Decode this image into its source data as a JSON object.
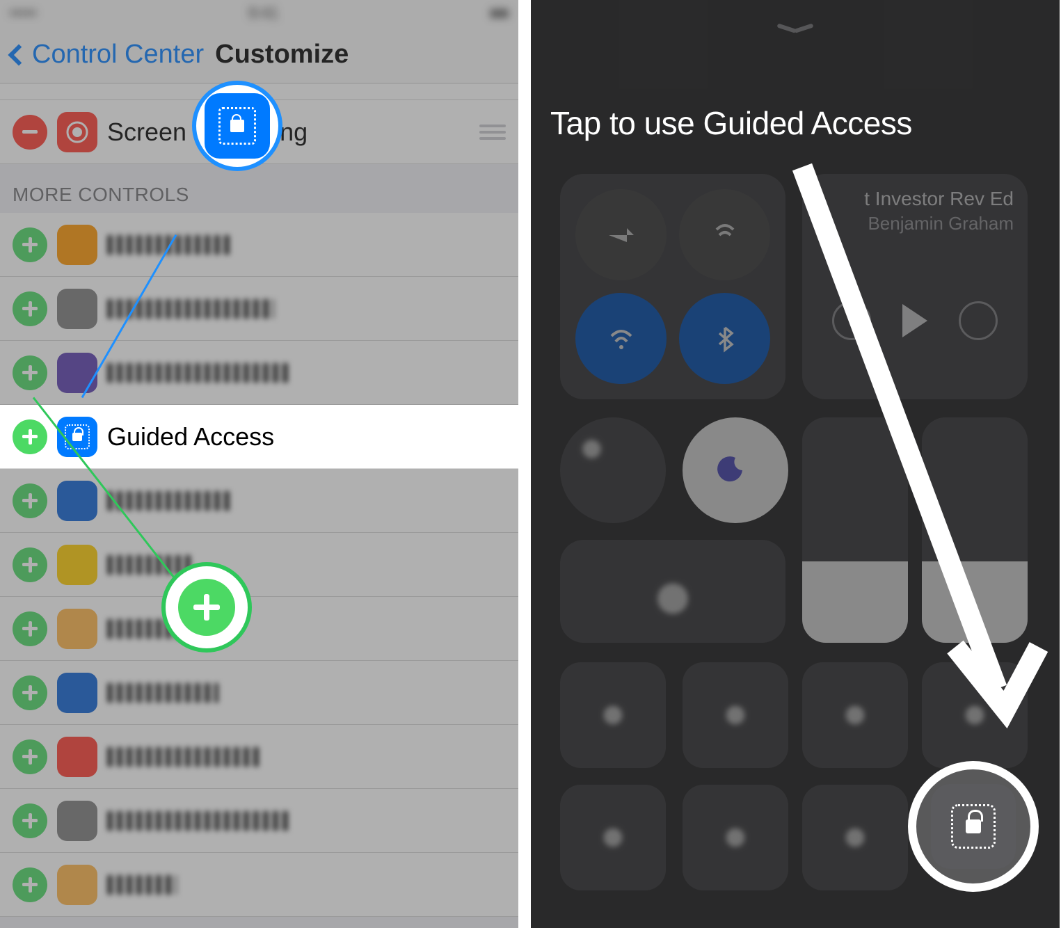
{
  "left": {
    "nav": {
      "back_label": "Control Center",
      "title": "Customize"
    },
    "included_row": {
      "label": "Screen Recording"
    },
    "section_header": "MORE CONTROLS",
    "guided_row": {
      "label": "Guided Access"
    },
    "callouts": {
      "lock_icon_name": "guided-access-icon",
      "add_icon_name": "add-icon"
    }
  },
  "right": {
    "headline": "Tap to use Guided Access",
    "media": {
      "title": "t Investor Rev Ed",
      "subtitle": "Benjamin Graham"
    },
    "target_icon_name": "guided-access-button"
  }
}
